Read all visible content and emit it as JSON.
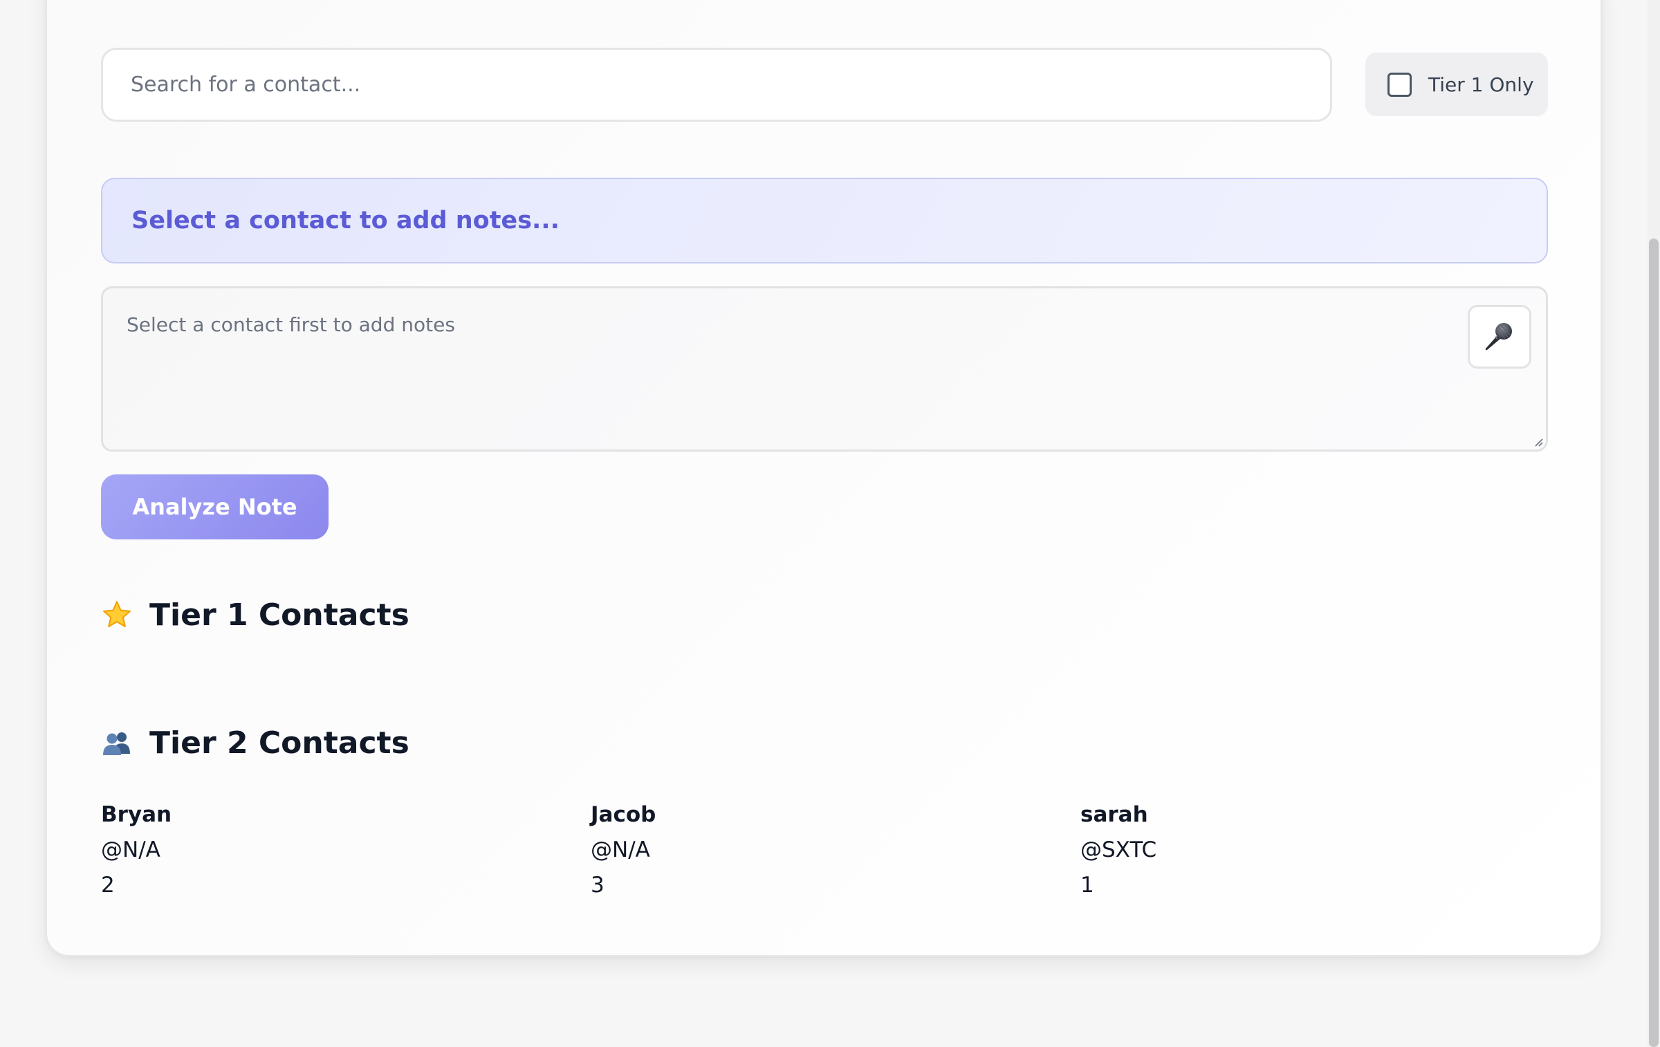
{
  "search": {
    "placeholder": "Search for a contact..."
  },
  "filter": {
    "tier1_only_label": "Tier 1 Only",
    "tier1_only_checked": false
  },
  "selected_contact": {
    "prompt": "Select a contact to add notes..."
  },
  "notes": {
    "placeholder": "Select a contact first to add notes",
    "mic_icon": "microphone-icon"
  },
  "actions": {
    "analyze_label": "Analyze Note"
  },
  "tier1": {
    "icon": "star-icon",
    "heading": "Tier 1 Contacts",
    "contacts": []
  },
  "tier2": {
    "icon": "people-icon",
    "heading": "Tier 2 Contacts",
    "contacts": [
      {
        "name": "Bryan",
        "handle": "@N/A",
        "count": "2"
      },
      {
        "name": "Jacob",
        "handle": "@N/A",
        "count": "3"
      },
      {
        "name": "sarah",
        "handle": "@SXTC",
        "count": "1"
      }
    ]
  },
  "colors": {
    "accent": "#5b5bd6",
    "button": "#9a98f2",
    "banner_bg": "#e8eafd"
  }
}
